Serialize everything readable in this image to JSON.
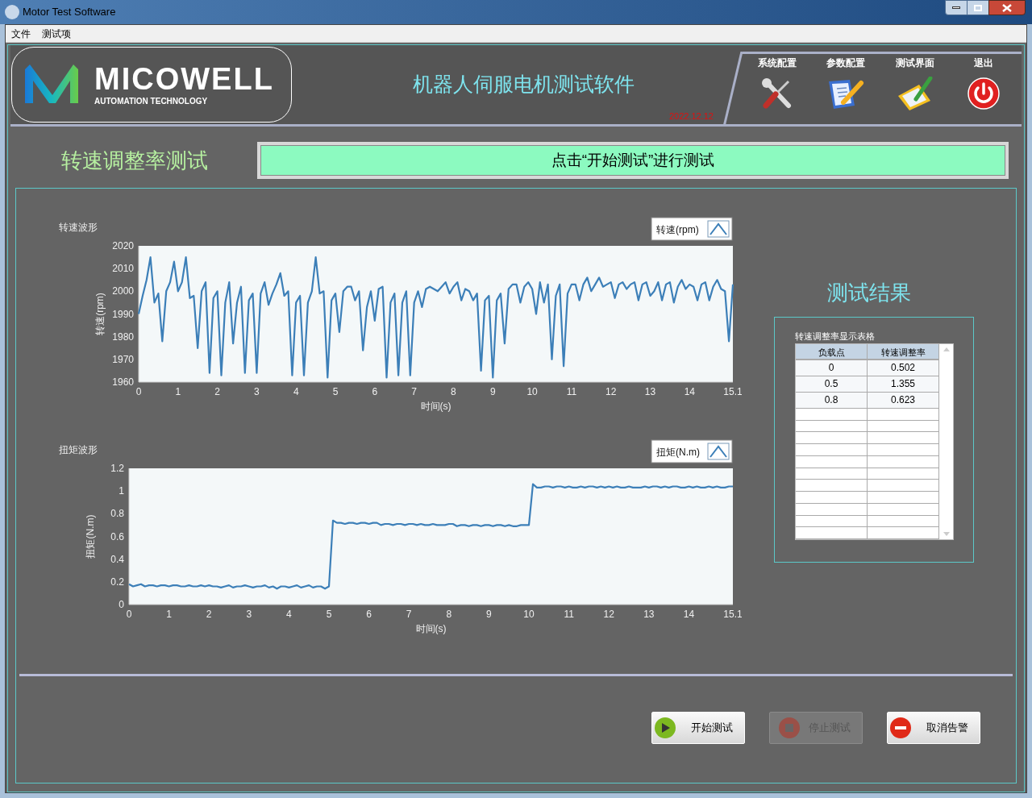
{
  "window": {
    "title": "Motor Test Software"
  },
  "menu": [
    "文件",
    "测试项"
  ],
  "header": {
    "logo_name": "MICOWELL",
    "logo_tagline": "AUTOMATION TECHNOLOGY",
    "title": "机器人伺服电机测试软件",
    "date": "2022.12.12",
    "nav": [
      {
        "label": "系统配置",
        "kind": "tools"
      },
      {
        "label": "参数配置",
        "kind": "edit"
      },
      {
        "label": "测试界面",
        "kind": "pad"
      },
      {
        "label": "退出",
        "kind": "power"
      }
    ]
  },
  "test_title": "转速调整率测试",
  "status_message": "点击“开始测试”进行测试",
  "charts": [
    {
      "chart_data": {
        "type": "line",
        "title": "转速波形",
        "xlabel": "时间(s)",
        "ylabel": "转速(rpm)",
        "xlim": [
          0,
          15.1
        ],
        "ylim": [
          1960,
          2020
        ],
        "xticks": [
          0,
          1,
          2,
          3,
          4,
          5,
          6,
          7,
          8,
          9,
          10,
          11,
          12,
          13,
          14,
          15.1
        ],
        "yticks": [
          1960,
          1970,
          1980,
          1990,
          2000,
          2010,
          2020
        ],
        "x": [
          0,
          0.1,
          0.2,
          0.3,
          0.4,
          0.5,
          0.6,
          0.7,
          0.8,
          0.9,
          1,
          1.1,
          1.2,
          1.3,
          1.4,
          1.5,
          1.6,
          1.7,
          1.8,
          1.9,
          2,
          2.1,
          2.2,
          2.3,
          2.4,
          2.5,
          2.6,
          2.7,
          2.8,
          2.9,
          3,
          3.1,
          3.2,
          3.3,
          3.4,
          3.5,
          3.6,
          3.7,
          3.8,
          3.9,
          4,
          4.1,
          4.2,
          4.3,
          4.4,
          4.5,
          4.6,
          4.7,
          4.8,
          4.9,
          5,
          5.1,
          5.2,
          5.3,
          5.4,
          5.5,
          5.6,
          5.7,
          5.8,
          5.9,
          6,
          6.1,
          6.2,
          6.3,
          6.4,
          6.5,
          6.6,
          6.7,
          6.8,
          6.9,
          7,
          7.1,
          7.2,
          7.3,
          7.4,
          7.5,
          7.6,
          7.7,
          7.8,
          7.9,
          8,
          8.1,
          8.2,
          8.3,
          8.4,
          8.5,
          8.6,
          8.7,
          8.8,
          8.9,
          9,
          9.1,
          9.2,
          9.3,
          9.4,
          9.5,
          9.6,
          9.7,
          9.8,
          9.9,
          10,
          10.1,
          10.2,
          10.3,
          10.4,
          10.5,
          10.6,
          10.7,
          10.8,
          10.9,
          11,
          11.1,
          11.2,
          11.3,
          11.4,
          11.5,
          11.6,
          11.7,
          11.8,
          11.9,
          12,
          12.1,
          12.2,
          12.3,
          12.4,
          12.5,
          12.6,
          12.7,
          12.8,
          12.9,
          13,
          13.1,
          13.2,
          13.3,
          13.4,
          13.5,
          13.6,
          13.7,
          13.8,
          13.9,
          14,
          14.1,
          14.2,
          14.3,
          14.4,
          14.5,
          14.6,
          14.7,
          14.8,
          14.9,
          15,
          15.1
        ],
        "series": [
          {
            "name": "转速(rpm)",
            "color": "#3c7fb8",
            "values": [
              1990,
              1998,
              2005,
              2015,
              1995,
              1999,
              1978,
              2000,
              2004,
              2013,
              2000,
              2004,
              2015,
              1997,
              1998,
              1975,
              2000,
              2004,
              1964,
              1997,
              2000,
              1963,
              1995,
              2004,
              1977,
              1995,
              2002,
              1964,
              1996,
              1999,
              1964,
              1999,
              2004,
              1994,
              1999,
              2003,
              2008,
              1998,
              2000,
              1963,
              1995,
              1998,
              1963,
              1995,
              2000,
              2015,
              1999,
              2000,
              1962,
              1996,
              1999,
              1982,
              2000,
              2002,
              2002,
              1996,
              2000,
              1974,
              1993,
              2000,
              1987,
              2001,
              2002,
              1962,
              1995,
              1999,
              1963,
              1995,
              2000,
              1963,
              1995,
              2000,
              1993,
              2001,
              2002,
              2001,
              2000,
              2002,
              2004,
              1999,
              2002,
              2004,
              1996,
              2001,
              2000,
              1996,
              1999,
              1965,
              1996,
              1998,
              1962,
              1996,
              1999,
              1977,
              2001,
              2003,
              2003,
              1995,
              2002,
              2004,
              2001,
              1990,
              2004,
              1995,
              2003,
              1970,
              1998,
              2003,
              1967,
              1999,
              2003,
              2003,
              1996,
              2003,
              2006,
              2000,
              2003,
              2006,
              2002,
              2003,
              2004,
              1997,
              2003,
              2004,
              2001,
              2003,
              2004,
              1996,
              2003,
              2004,
              1998,
              2000,
              2004,
              1996,
              2003,
              2004,
              1995,
              2002,
              2005,
              2001,
              2003,
              2002,
              1996,
              2003,
              2004,
              1996,
              2002,
              2005,
              2001,
              2000,
              1978,
              2003
            ]
          }
        ]
      }
    },
    {
      "chart_data": {
        "type": "line",
        "title": "扭矩波形",
        "xlabel": "时间(s)",
        "ylabel": "扭矩(N.m)",
        "xlim": [
          0,
          15.1
        ],
        "ylim": [
          0,
          1.2
        ],
        "xticks": [
          0,
          1,
          2,
          3,
          4,
          5,
          6,
          7,
          8,
          9,
          10,
          11,
          12,
          13,
          14,
          15.1
        ],
        "yticks": [
          0,
          0.2,
          0.4,
          0.6,
          0.8,
          1,
          1.2
        ],
        "x": [
          0,
          0.1,
          0.2,
          0.3,
          0.4,
          0.5,
          0.6,
          0.7,
          0.8,
          0.9,
          1,
          1.1,
          1.2,
          1.3,
          1.4,
          1.5,
          1.6,
          1.7,
          1.8,
          1.9,
          2,
          2.1,
          2.2,
          2.3,
          2.4,
          2.5,
          2.6,
          2.7,
          2.8,
          2.9,
          3,
          3.1,
          3.2,
          3.3,
          3.4,
          3.5,
          3.6,
          3.7,
          3.8,
          3.9,
          4,
          4.1,
          4.2,
          4.3,
          4.4,
          4.5,
          4.6,
          4.7,
          4.8,
          4.9,
          5,
          5.1,
          5.2,
          5.3,
          5.4,
          5.5,
          5.6,
          5.7,
          5.8,
          5.9,
          6,
          6.1,
          6.2,
          6.3,
          6.4,
          6.5,
          6.6,
          6.7,
          6.8,
          6.9,
          7,
          7.1,
          7.2,
          7.3,
          7.4,
          7.5,
          7.6,
          7.7,
          7.8,
          7.9,
          8,
          8.1,
          8.2,
          8.3,
          8.4,
          8.5,
          8.6,
          8.7,
          8.8,
          8.9,
          9,
          9.1,
          9.2,
          9.3,
          9.4,
          9.5,
          9.6,
          9.7,
          9.8,
          9.9,
          10,
          10.1,
          10.2,
          10.3,
          10.4,
          10.5,
          10.6,
          10.7,
          10.8,
          10.9,
          11,
          11.1,
          11.2,
          11.3,
          11.4,
          11.5,
          11.6,
          11.7,
          11.8,
          11.9,
          12,
          12.1,
          12.2,
          12.3,
          12.4,
          12.5,
          12.6,
          12.7,
          12.8,
          12.9,
          13,
          13.1,
          13.2,
          13.3,
          13.4,
          13.5,
          13.6,
          13.7,
          13.8,
          13.9,
          14,
          14.1,
          14.2,
          14.3,
          14.4,
          14.5,
          14.6,
          14.7,
          14.8,
          14.9,
          15,
          15.1
        ],
        "series": [
          {
            "name": "扭矩(N.m)",
            "color": "#3c7fb8",
            "values": [
              0.18,
              0.16,
              0.17,
              0.18,
              0.16,
              0.17,
              0.17,
              0.16,
              0.17,
              0.17,
              0.16,
              0.17,
              0.17,
              0.16,
              0.16,
              0.17,
              0.16,
              0.16,
              0.17,
              0.16,
              0.17,
              0.16,
              0.16,
              0.15,
              0.16,
              0.17,
              0.15,
              0.16,
              0.16,
              0.17,
              0.16,
              0.15,
              0.16,
              0.16,
              0.17,
              0.15,
              0.16,
              0.14,
              0.16,
              0.16,
              0.15,
              0.16,
              0.17,
              0.15,
              0.16,
              0.17,
              0.15,
              0.16,
              0.16,
              0.14,
              0.16,
              0.74,
              0.72,
              0.72,
              0.71,
              0.72,
              0.72,
              0.71,
              0.72,
              0.72,
              0.71,
              0.72,
              0.72,
              0.7,
              0.71,
              0.71,
              0.7,
              0.71,
              0.71,
              0.7,
              0.71,
              0.71,
              0.7,
              0.71,
              0.7,
              0.7,
              0.71,
              0.7,
              0.7,
              0.7,
              0.71,
              0.71,
              0.69,
              0.7,
              0.7,
              0.69,
              0.7,
              0.7,
              0.69,
              0.7,
              0.7,
              0.69,
              0.7,
              0.7,
              0.69,
              0.7,
              0.69,
              0.69,
              0.7,
              0.7,
              0.7,
              1.06,
              1.03,
              1.03,
              1.04,
              1.04,
              1.03,
              1.04,
              1.04,
              1.03,
              1.04,
              1.03,
              1.03,
              1.04,
              1.03,
              1.04,
              1.04,
              1.03,
              1.04,
              1.03,
              1.04,
              1.03,
              1.04,
              1.03,
              1.03,
              1.04,
              1.03,
              1.03,
              1.03,
              1.04,
              1.03,
              1.04,
              1.04,
              1.03,
              1.04,
              1.03,
              1.04,
              1.04,
              1.03,
              1.03,
              1.04,
              1.03,
              1.04,
              1.03,
              1.03,
              1.04,
              1.03,
              1.04,
              1.03,
              1.03,
              1.04,
              1.04
            ]
          }
        ]
      }
    }
  ],
  "results": {
    "title": "测试结果",
    "table_caption": "转速调整率显示表格",
    "columns": [
      "负载点",
      "转速调整率"
    ],
    "rows": [
      [
        "0",
        "0.502"
      ],
      [
        "0.5",
        "1.355"
      ],
      [
        "0.8",
        "0.623"
      ]
    ]
  },
  "buttons": [
    {
      "label": "开始测试",
      "kind": "start",
      "disabled": false
    },
    {
      "label": "停止测试",
      "kind": "stop",
      "disabled": true
    },
    {
      "label": "取消告警",
      "kind": "cancel",
      "disabled": false
    }
  ]
}
